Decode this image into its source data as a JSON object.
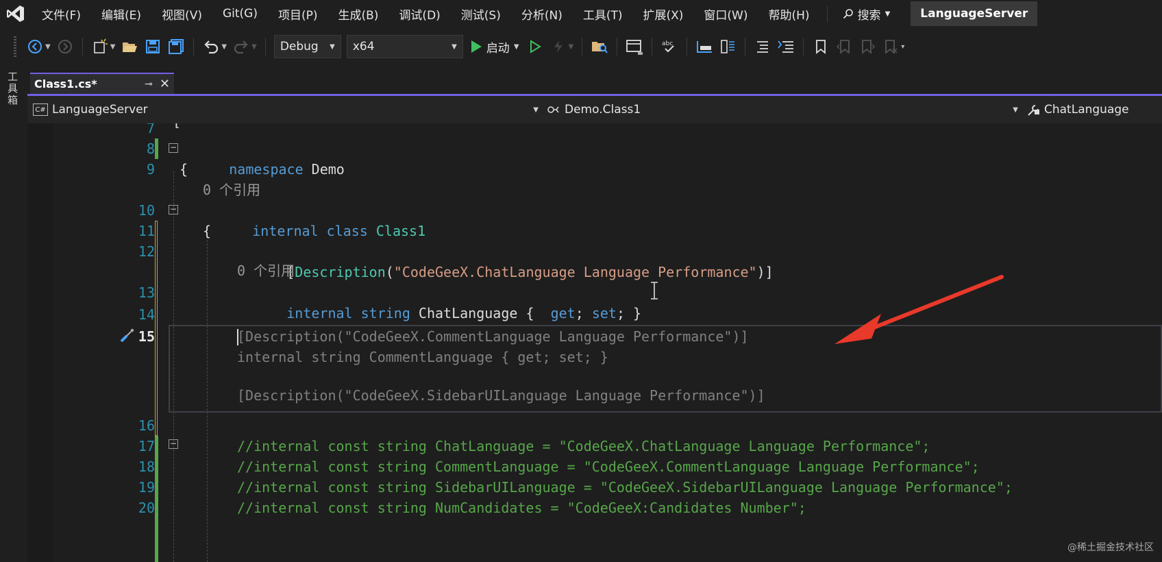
{
  "menu": {
    "items": [
      "文件(F)",
      "编辑(E)",
      "视图(V)",
      "Git(G)",
      "项目(P)",
      "生成(B)",
      "调试(D)",
      "测试(S)",
      "分析(N)",
      "工具(T)",
      "扩展(X)",
      "窗口(W)",
      "帮助(H)"
    ],
    "search_label": "搜索",
    "solution_name": "LanguageServer"
  },
  "toolbar": {
    "config_value": "Debug",
    "platform_value": "x64",
    "start_label": "启动"
  },
  "left_strip": {
    "toolbox_label": "工具箱"
  },
  "tab": {
    "title": "Class1.cs*"
  },
  "nav": {
    "project": "LanguageServer",
    "type": "Demo.Class1",
    "member": "ChatLanguage"
  },
  "editor": {
    "top_partial": "[",
    "line_numbers": {
      "l7": "7",
      "l8": "8",
      "l9": "9",
      "l10": "10",
      "l11": "11",
      "l12": "12",
      "l13": "13",
      "l14": "14",
      "l15": "15",
      "l16": "16",
      "l17": "17",
      "l18": "18",
      "l19": "19",
      "l20": "20"
    },
    "codelens": {
      "ref1": "0 个引用",
      "ref2": "0 个引用"
    },
    "code": {
      "l8_kw": "namespace",
      "l8_name": " Demo",
      "l9": "{",
      "l10_kw1": "internal",
      "l10_kw2": " class",
      "l10_type": " Class1",
      "l11": "{",
      "l12_open": "[",
      "l12_attr": "Description",
      "l12_paren": "(",
      "l12_str": "\"CodeGeeX.ChatLanguage Language Performance\"",
      "l12_close": ")]",
      "l13_kw1": "internal",
      "l13_kw2": " string",
      "l13_name": " ChatLanguage",
      "l13_brace": " {  ",
      "l13_get": "get",
      "l13_semi1": "; ",
      "l13_set": "set",
      "l13_end": "; }",
      "l17": "//internal const string ChatLanguage = \"CodeGeeX.ChatLanguage Language Performance\";",
      "l18": "//internal const string CommentLanguage = \"CodeGeeX.CommentLanguage Language Performance\";",
      "l19": "//internal const string SidebarUILanguage = \"CodeGeeX.SidebarUILanguage Language Performance\";",
      "l20": "//internal const string NumCandidates = \"CodeGeeX:Candidates Number\";"
    },
    "suggestion": {
      "g1": "[Description(\"CodeGeeX.CommentLanguage Language Performance\")]",
      "g2": "internal string CommentLanguage { get; set; }",
      "g3": "[Description(\"CodeGeeX.SidebarUILanguage Language Performance\")]"
    }
  },
  "watermark": "@稀土掘金技术社区",
  "colors": {
    "keyword": "#569cd6",
    "type": "#4ec9b0",
    "string": "#d69d85",
    "comment": "#57a64a",
    "line_number": "#2b91af",
    "accent": "#7160e8",
    "arrow": "#e8392a"
  }
}
